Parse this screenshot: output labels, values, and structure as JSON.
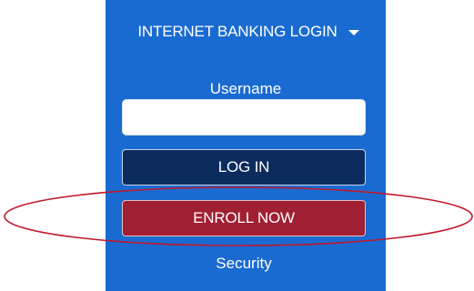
{
  "login_panel": {
    "header_title": "INTERNET BANKING LOGIN",
    "header_icon": "caret-down-icon",
    "username_label": "Username",
    "username_value": "",
    "username_placeholder": "",
    "login_button_label": "LOG IN",
    "enroll_button_label": "ENROLL NOW",
    "security_link_label": "Security"
  },
  "colors": {
    "panel_background": "#1a6bd1",
    "login_button": "#0c2c5e",
    "enroll_button": "#a01f33",
    "highlight_ellipse": "#c0182c"
  }
}
